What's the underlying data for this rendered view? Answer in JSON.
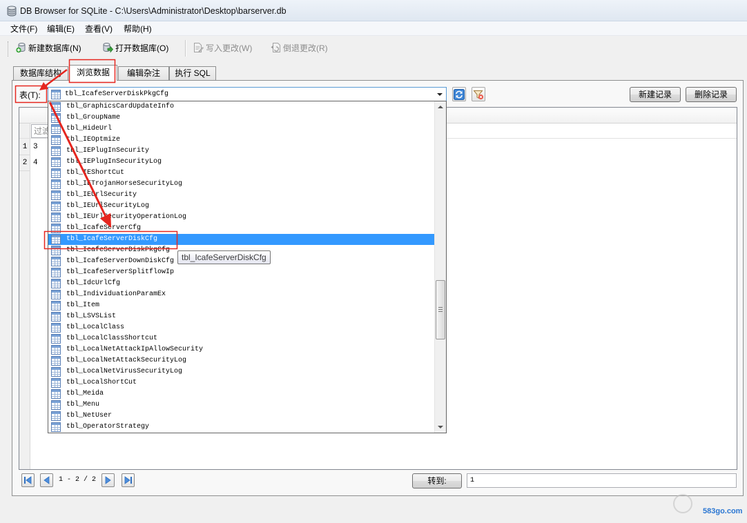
{
  "window": {
    "title": "DB Browser for SQLite - C:\\Users\\Administrator\\Desktop\\barserver.db",
    "icon": "database-icon"
  },
  "menu": {
    "items": [
      {
        "label": "文件(F)"
      },
      {
        "label": "编辑(E)"
      },
      {
        "label": "查看(V)"
      },
      {
        "label": "帮助(H)"
      }
    ]
  },
  "toolbar": {
    "items": [
      {
        "label": "新建数据库(N)",
        "icon": "new-database-icon",
        "enabled": true
      },
      {
        "label": "打开数据库(O)",
        "icon": "open-database-icon",
        "enabled": true
      },
      {
        "label": "写入更改(W)",
        "icon": "write-changes-icon",
        "enabled": false
      },
      {
        "label": "倒退更改(R)",
        "icon": "revert-changes-icon",
        "enabled": false
      }
    ]
  },
  "tabs": {
    "items": [
      {
        "label": "数据库结构",
        "active": false
      },
      {
        "label": "浏览数据",
        "active": true
      },
      {
        "label": "编辑杂注",
        "active": false
      },
      {
        "label": "执行 SQL",
        "active": false
      }
    ]
  },
  "browse": {
    "table_label": "表(T):",
    "selected_table": "tbl_IcafeServerDiskPkgCfg",
    "refresh_icon": "refresh-icon",
    "clear_filters_icon": "clear-filter-icon",
    "new_record_label": "新建记录",
    "delete_record_label": "删除记录",
    "grid": {
      "filter_placeholder": "过滤",
      "rows": [
        {
          "row_number": "1",
          "value": "3"
        },
        {
          "row_number": "2",
          "value": "4"
        }
      ]
    },
    "pagination": {
      "position_text": "1 - 2 / 2",
      "goto_label": "转到:",
      "goto_value": "1"
    }
  },
  "dropdown": {
    "items": [
      "tbl_GraphicsCardUpdateInfo",
      "tbl_GroupName",
      "tbl_HideUrl",
      "tbl_IEOptmize",
      "tbl_IEPlugInSecurity",
      "tbl_IEPlugInSecurityLog",
      "tbl_IEShortCut",
      "tbl_IETrojanHorseSecurityLog",
      "tbl_IEUrlSecurity",
      "tbl_IEUrlSecurityLog",
      "tbl_IEUrlSecurityOperationLog",
      "tbl_IcafeServerCfg",
      "tbl_IcafeServerDiskCfg",
      "tbl_IcafeServerDiskPkgCfg",
      "tbl_IcafeServerDownDiskCfg",
      "tbl_IcafeServerSplitflowIp",
      "tbl_IdcUrlCfg",
      "tbl_IndividuationParamEx",
      "tbl_Item",
      "tbl_LSVSList",
      "tbl_LocalClass",
      "tbl_LocalClassShortcut",
      "tbl_LocalNetAttackIpAllowSecurity",
      "tbl_LocalNetAttackSecurityLog",
      "tbl_LocalNetVirusSecurityLog",
      "tbl_LocalShortCut",
      "tbl_Meida",
      "tbl_Menu",
      "tbl_NetUser",
      "tbl_OperatorStrategy"
    ],
    "item_icon": "table-icon",
    "highlighted_index": 12,
    "scroll_fraction": 0.67
  },
  "tooltip": {
    "text": "tbl_IcafeServerDiskCfg"
  },
  "watermark": {
    "text": "583go.com"
  },
  "colors": {
    "selection": "#3399ff",
    "annotation": "#e5261f",
    "accent_blue": "#2f6fc0",
    "disabled_text": "#8d8d8d"
  }
}
